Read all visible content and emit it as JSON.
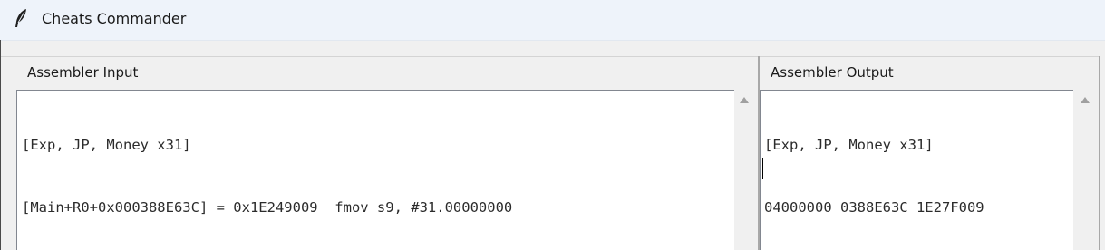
{
  "window": {
    "title": "Cheats Commander",
    "icon": "feather-icon"
  },
  "assembler_input": {
    "label": "Assembler Input",
    "lines": [
      "[Exp, JP, Money x31]",
      "[Main+R0+0x000388E63C] = 0x1E249009  fmov s9, #31.00000000"
    ]
  },
  "assembler_output": {
    "label": "Assembler Output",
    "lines": [
      "[Exp, JP, Money x31]",
      "04000000 0388E63C 1E27F009"
    ]
  }
}
